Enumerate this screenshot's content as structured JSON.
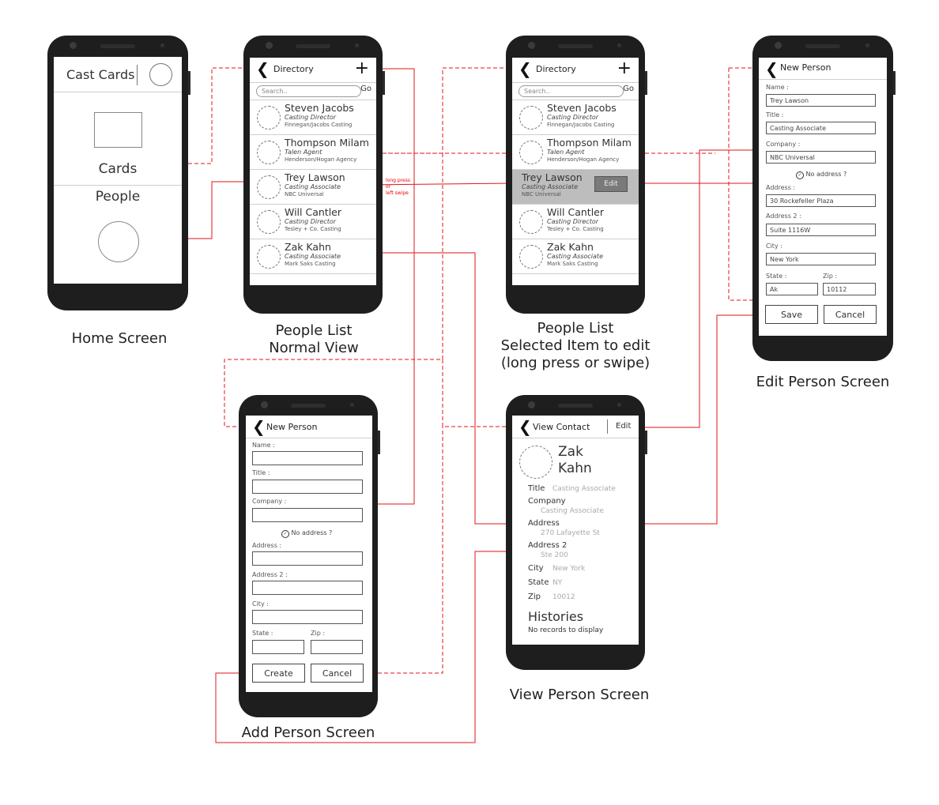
{
  "captions": {
    "home": "Home Screen",
    "list_normal_1": "People List",
    "list_normal_2": "Normal View",
    "list_sel_1": "People List",
    "list_sel_2": "Selected Item to edit",
    "list_sel_3": "(long press or swipe)",
    "edit": "Edit Person Screen",
    "add": "Add Person Screen",
    "view": "View Person Screen"
  },
  "home": {
    "title": "Cast Cards",
    "cards": "Cards",
    "people": "People"
  },
  "directory": {
    "title": "Directory",
    "plus": "+",
    "search_placeholder": "Search..",
    "go": "Go",
    "people": [
      {
        "name": "Steven Jacobs",
        "role": "Casting Director",
        "company": "Finnegan/Jacobs Casting"
      },
      {
        "name": "Thompson Milam",
        "role": "Talen Agent",
        "company": "Henderson/Hogan Agency"
      },
      {
        "name": "Trey Lawson",
        "role": "Casting Associate",
        "company": "NBC Universal"
      },
      {
        "name": "Will Cantler",
        "role": "Casting Director",
        "company": "Tesley + Co. Casting"
      },
      {
        "name": "Zak Kahn",
        "role": "Casting Associate",
        "company": "Mark Saks Casting"
      }
    ],
    "edit_label": "Edit",
    "gesture_note": [
      "long press",
      "or",
      "left swipe"
    ]
  },
  "form": {
    "title": "New Person",
    "name_label": "Name :",
    "title_label": "Title :",
    "company_label": "Company :",
    "no_address": "No address ?",
    "address_label": "Address :",
    "address2_label": "Address 2 :",
    "city_label": "City :",
    "state_label": "State :",
    "zip_label": "Zip :",
    "create": "Create",
    "cancel": "Cancel",
    "save": "Save"
  },
  "edit_values": {
    "name": "Trey Lawson",
    "title": "Casting Associate",
    "company": "NBC Universal",
    "address": "30 Rockefeller Plaza",
    "address2": "Suite 1116W",
    "city": "New York",
    "state": "Ak",
    "zip": "10112"
  },
  "view": {
    "title": "View Contact",
    "edit": "Edit",
    "first": "Zak",
    "last": "Kahn",
    "title_label": "Title",
    "title_value": "Casting Associate",
    "company_label": "Company",
    "company_value": "Casting Associate",
    "address_label": "Address",
    "address_value": "270 Lafayette St",
    "address2_label": "Address 2",
    "address2_value": "Ste 200",
    "city_label": "City",
    "city_value": "New York",
    "state_label": "State",
    "state_value": "NY",
    "zip_label": "Zip",
    "zip_value": "10012",
    "histories": "Histories",
    "no_records": "No records to display"
  },
  "colors": {
    "connector": "#e0161b",
    "phone": "#1e1e1e",
    "selected_row": "#bdbdbd"
  }
}
